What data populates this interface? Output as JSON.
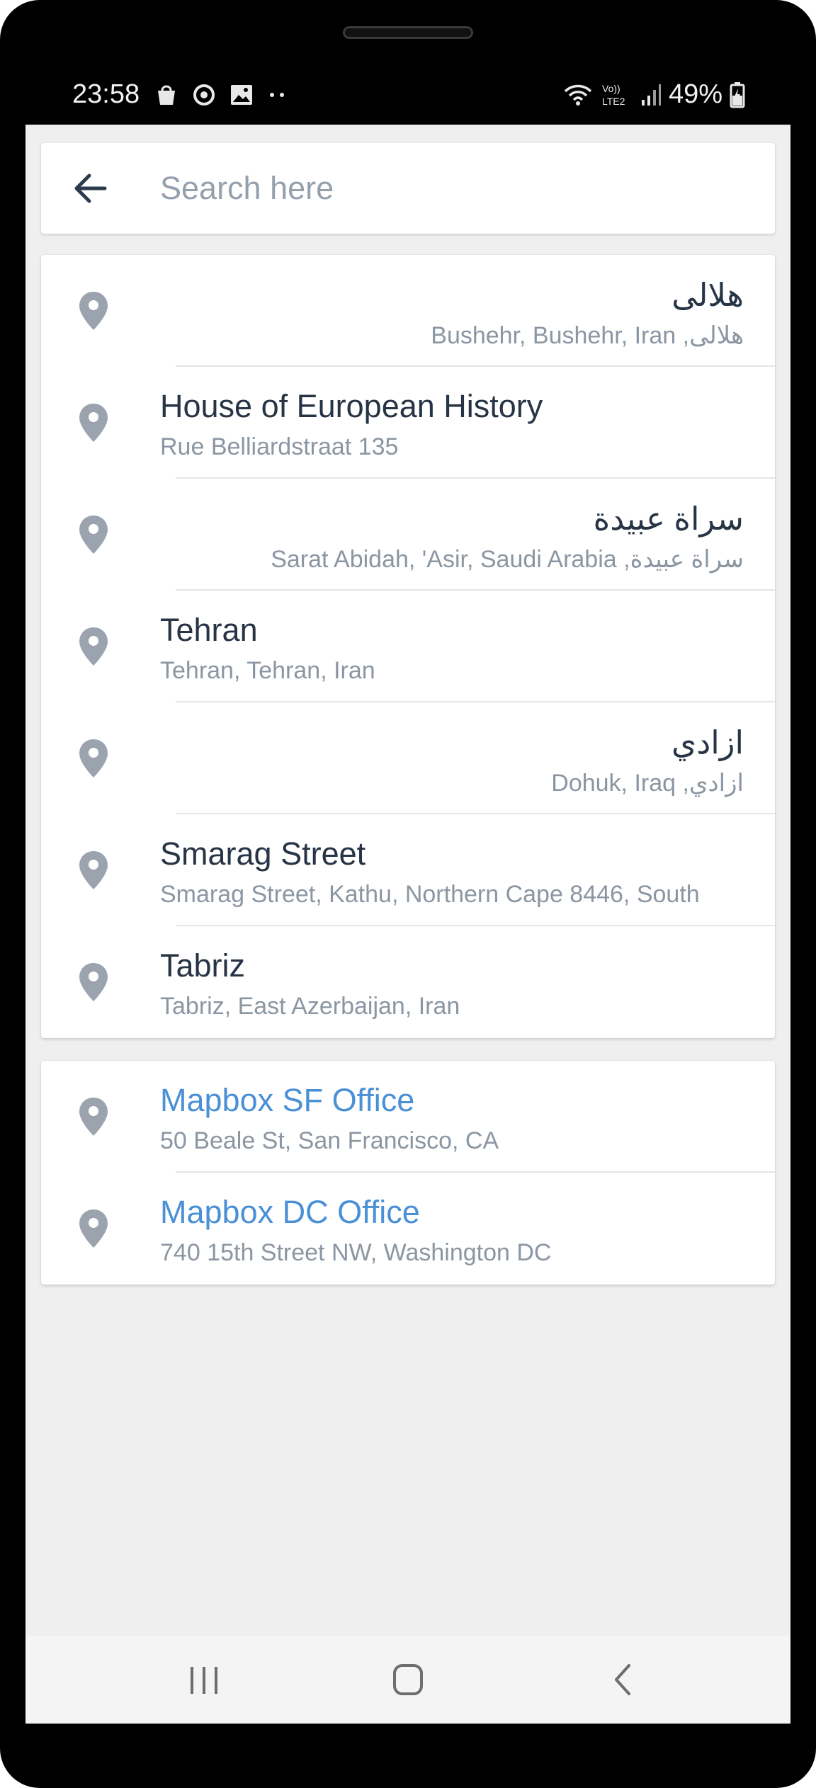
{
  "status_bar": {
    "time": "23:58",
    "battery": "49%",
    "network_label": "Vo)) LTE2",
    "icons_left": [
      "shopping-bag-icon",
      "sync-icon",
      "image-icon",
      "more-dots-icon"
    ],
    "icons_right": [
      "wifi-icon",
      "signal-icon",
      "battery-icon"
    ]
  },
  "search": {
    "placeholder": "Search here",
    "value": ""
  },
  "results": [
    {
      "title": "هلالی",
      "subtitle": "Bushehr, Bushehr, Iran ,هلالی",
      "rtl": true
    },
    {
      "title": "House of European History",
      "subtitle": "Rue Belliardstraat 135",
      "rtl": false
    },
    {
      "title": "سراة عبيدة",
      "subtitle": "Sarat Abidah, 'Asir, Saudi Arabia ,سراة عبيدة",
      "rtl": true
    },
    {
      "title": "Tehran",
      "subtitle": "Tehran, Tehran, Iran",
      "rtl": false
    },
    {
      "title": "ازادي",
      "subtitle": "Dohuk, Iraq ,ازادي",
      "rtl": true
    },
    {
      "title": "Smarag Street",
      "subtitle": "Smarag Street, Kathu, Northern Cape 8446, South",
      "rtl": false
    },
    {
      "title": "Tabriz",
      "subtitle": "Tabriz, East Azerbaijan, Iran",
      "rtl": false
    }
  ],
  "favorites": [
    {
      "title": "Mapbox SF Office",
      "subtitle": "50 Beale St, San Francisco, CA"
    },
    {
      "title": "Mapbox DC Office",
      "subtitle": "740 15th Street NW, Washington DC"
    }
  ],
  "colors": {
    "title": "#263445",
    "subtitle": "#8b96a3",
    "favorite_title": "#4a90d6",
    "pin": "#9aa3ae",
    "background": "#efefef"
  },
  "navigation": {
    "icons": [
      "recent-apps-icon",
      "home-icon",
      "back-icon"
    ]
  }
}
